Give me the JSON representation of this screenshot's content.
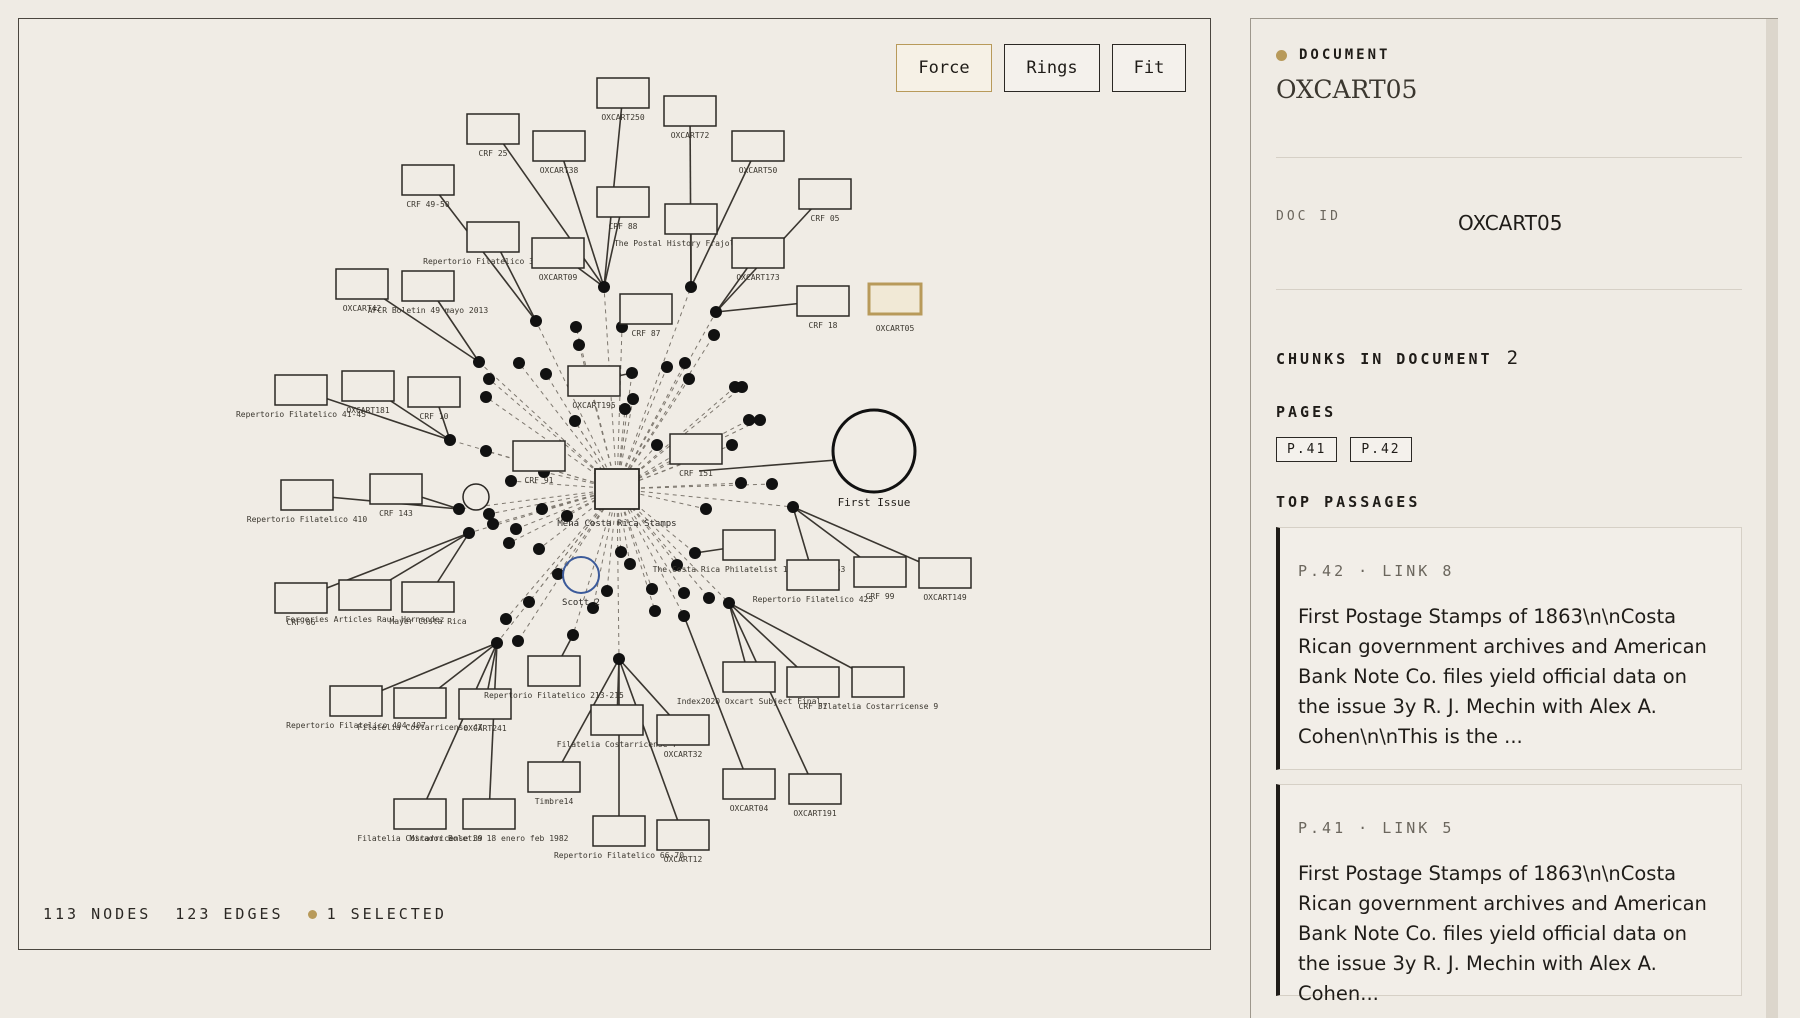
{
  "graph": {
    "toolbar": {
      "force": "Force",
      "rings": "Rings",
      "fit": "Fit"
    },
    "status": {
      "nodes": "113 NODES",
      "edges": "123 EDGES",
      "selected": "1 SELECTED"
    },
    "colors": {
      "accent": "#b89a5a",
      "ink": "#2b2824"
    },
    "hub_label": "Mena Costa Rica Stamps",
    "labels": {
      "oxcart250": "OXCART250",
      "oxcart72": "OXCART72",
      "crf25": "CRF 25",
      "oxcart38": "OXCART38",
      "oxcart50": "OXCART50",
      "crf49": "CRF 49-50",
      "crf88": "CRF 88",
      "crf05": "CRF 05",
      "repfil311": "Repertorio Filatelico 311-315",
      "oxcart09": "OXCART09",
      "postal": "The Postal History Frajola Mayer",
      "oxcart173": "OXCART173",
      "oxcart42": "OXCART42",
      "afcr": "AFCR Boletin 49 mayo 2013",
      "crf87": "CRF 87",
      "crf18": "CRF 18",
      "oxcart05": "OXCART05",
      "rep4145": "Repertorio Filatelico 41-45",
      "oxcart181": "OXCART181",
      "crf10": "CRF 10",
      "oxcart195": "OXCART195",
      "firstissue": "First Issue",
      "rep410": "Repertorio Filatelico 410",
      "crf143": "CRF 143",
      "crf91": "CRF 91",
      "crf151": "CRF 151",
      "scott2": "Scott 2",
      "costarica": "The Costa Rica Philatelist 14 April 1953",
      "rep425": "Repertorio Filatelico 425",
      "crf99": "CRF 99",
      "oxcart149": "OXCART149",
      "crf06": "CRF 06",
      "forgeries": "Forgeries Articles Raul Hernandez",
      "mayer": "Mayer Costa Rica",
      "rep404": "Repertorio Filatelico 404-407",
      "fc47": "Filatelia Costarricense 47",
      "oxcart241": "OXCART241",
      "rep213": "Repertorio Filatelico 213-215",
      "fc7": "Filatelia Costarricense 7",
      "oxcart32": "OXCART32",
      "index2020": "Index2020 Oxcart Subject Final",
      "crf37": "CRF 37",
      "fc9": "Filatelia Costarricense 9",
      "timbre14": "Timbre14",
      "oxcart04": "OXCART04",
      "oxcart191": "OXCART191",
      "fc39": "Filatelia Costarricense 39",
      "mirador": "Mirador Boletin 18 enero feb 1982",
      "rep6670": "Repertorio Filatelico 66-70",
      "oxcart12": "OXCART12"
    }
  },
  "document": {
    "type_label": "DOCUMENT",
    "title": "OXCART05",
    "doc_id_label": "DOC ID",
    "doc_id": "OXCART05",
    "chunks_label": "CHUNKS IN DOCUMENT",
    "chunks_count": "2",
    "pages_label": "PAGES",
    "pages": [
      "P.41",
      "P.42"
    ],
    "passages_label": "TOP PASSAGES",
    "passages": [
      {
        "meta": "P.42 · LINK 8",
        "text": "First Postage Stamps of 1863\\n\\nCosta Rican government archives and American Bank Note Co. files yield official data on the issue 3y R. J. Mechin with Alex A. Cohen\\n\\nThis is the ..."
      },
      {
        "meta": "P.41 · LINK 5",
        "text": "First Postage Stamps of 1863\\n\\nCosta Rican government archives and American Bank Note Co. files yield official data on the issue 3y R. J. Mechin with Alex A. Cohen..."
      }
    ]
  }
}
